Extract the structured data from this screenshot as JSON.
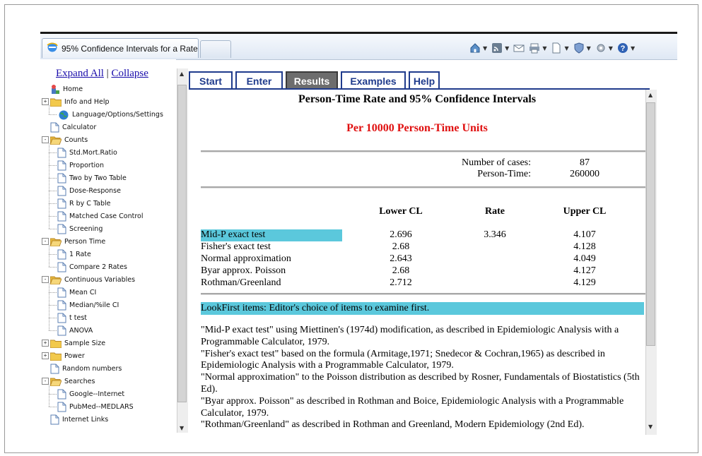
{
  "browser": {
    "tab_title": "95% Confidence Intervals for a Rate",
    "toolbar_icons": [
      "home-icon",
      "feeds-icon",
      "read-mail-icon",
      "print-icon",
      "page-icon",
      "safety-icon",
      "tools-icon",
      "help-icon"
    ]
  },
  "sidebar": {
    "expand_all": "Expand All",
    "separator": "|",
    "collapse": "Collapse",
    "tree": [
      {
        "label": "Home",
        "level": 0,
        "kind": "home",
        "exp": ""
      },
      {
        "label": "Info and Help",
        "level": 0,
        "kind": "folder",
        "exp": "+"
      },
      {
        "label": "Language/Options/Settings",
        "level": 1,
        "kind": "globe",
        "exp": ""
      },
      {
        "label": "Calculator",
        "level": 0,
        "kind": "page",
        "exp": ""
      },
      {
        "label": "Counts",
        "level": 0,
        "kind": "folder-open",
        "exp": "-"
      },
      {
        "label": "Std.Mort.Ratio",
        "level": 1,
        "kind": "page",
        "exp": ""
      },
      {
        "label": "Proportion",
        "level": 1,
        "kind": "page",
        "exp": ""
      },
      {
        "label": "Two by Two Table",
        "level": 1,
        "kind": "page",
        "exp": ""
      },
      {
        "label": "Dose-Response",
        "level": 1,
        "kind": "page",
        "exp": ""
      },
      {
        "label": "R by C Table",
        "level": 1,
        "kind": "page",
        "exp": ""
      },
      {
        "label": "Matched Case Control",
        "level": 1,
        "kind": "page",
        "exp": ""
      },
      {
        "label": "Screening",
        "level": 1,
        "kind": "page",
        "exp": ""
      },
      {
        "label": "Person Time",
        "level": 0,
        "kind": "folder-open",
        "exp": "-"
      },
      {
        "label": "1 Rate",
        "level": 1,
        "kind": "page",
        "exp": ""
      },
      {
        "label": "Compare 2 Rates",
        "level": 1,
        "kind": "page",
        "exp": ""
      },
      {
        "label": "Continuous Variables",
        "level": 0,
        "kind": "folder-open",
        "exp": "-"
      },
      {
        "label": "Mean CI",
        "level": 1,
        "kind": "page",
        "exp": ""
      },
      {
        "label": "Median/%ile CI",
        "level": 1,
        "kind": "page",
        "exp": ""
      },
      {
        "label": "t test",
        "level": 1,
        "kind": "page",
        "exp": ""
      },
      {
        "label": "ANOVA",
        "level": 1,
        "kind": "page",
        "exp": ""
      },
      {
        "label": "Sample Size",
        "level": 0,
        "kind": "folder",
        "exp": "+"
      },
      {
        "label": "Power",
        "level": 0,
        "kind": "folder",
        "exp": "+"
      },
      {
        "label": "Random numbers",
        "level": 0,
        "kind": "page",
        "exp": ""
      },
      {
        "label": "Searches",
        "level": 0,
        "kind": "folder-open",
        "exp": "-"
      },
      {
        "label": "Google--Internet",
        "level": 1,
        "kind": "page",
        "exp": ""
      },
      {
        "label": "PubMed--MEDLARS",
        "level": 1,
        "kind": "page",
        "exp": ""
      },
      {
        "label": "Internet Links",
        "level": 0,
        "kind": "page",
        "exp": ""
      }
    ]
  },
  "tabs": [
    {
      "label": "Start",
      "active": false
    },
    {
      "label": "Enter",
      "active": false
    },
    {
      "label": "Results",
      "active": true
    },
    {
      "label": "Examples",
      "active": false
    },
    {
      "label": "Help",
      "active": false
    }
  ],
  "results": {
    "title": "Person-Time Rate and 95% Confidence Intervals",
    "units": "Per 10000 Person-Time Units",
    "cases_label": "Number of cases:",
    "cases_value": "87",
    "persontime_label": "Person-Time:",
    "persontime_value": "260000",
    "columns": [
      "Lower CL",
      "Rate",
      "Upper CL"
    ],
    "rows": [
      {
        "name": "Mid-P exact test",
        "lower": "2.696",
        "rate": "3.346",
        "upper": "4.107",
        "highlight": true
      },
      {
        "name": "Fisher's exact test",
        "lower": "2.68",
        "rate": "",
        "upper": "4.128",
        "highlight": false
      },
      {
        "name": "Normal approximation",
        "lower": "2.643",
        "rate": "",
        "upper": "4.049",
        "highlight": false
      },
      {
        "name": "Byar approx. Poisson",
        "lower": "2.68",
        "rate": "",
        "upper": "4.127",
        "highlight": false
      },
      {
        "name": "Rothman/Greenland",
        "lower": "2.712",
        "rate": "",
        "upper": "4.129",
        "highlight": false
      }
    ],
    "lookfirst": "LookFirst items: Editor's choice of items to examine first.",
    "notes": [
      "\"Mid-P exact test\" using Miettinen's (1974d) modification, as described in Epidemiologic Analysis with a Programmable Calculator, 1979.",
      "\"Fisher's exact test\" based on the formula (Armitage,1971; Snedecor & Cochran,1965) as described in Epidemiologic Analysis with a Programmable Calculator, 1979.",
      "\"Normal approximation\" to the Poisson distribution as described by Rosner, Fundamentals of Biostatistics (5th Ed).",
      "\"Byar approx. Poisson\" as described in Rothman and Boice, Epidemiologic Analysis with a Programmable Calculator, 1979.",
      "\"Rothman/Greenland\" as described in Rothman and Greenland, Modern Epidemiology (2nd Ed)."
    ]
  },
  "colors": {
    "highlight": "#5bc8dc",
    "units_red": "#e01010",
    "tab_blue": "#1f3b8c",
    "active_tab": "#6d6d6d"
  }
}
